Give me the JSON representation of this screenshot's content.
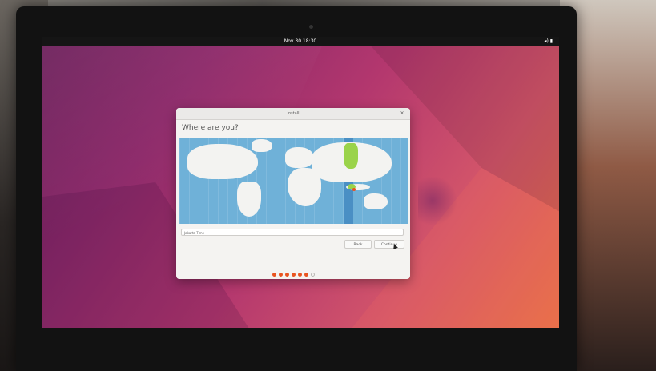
{
  "topbar": {
    "clock": "Nov 30  18:30",
    "status_icons": "◂) ▮"
  },
  "window": {
    "title": "Install",
    "heading": "Where are you?",
    "timezone_value": "Jakarta Time",
    "back_label": "Back",
    "continue_label": "Continue"
  },
  "progress": {
    "current_step": 6,
    "total_steps": 7
  },
  "colors": {
    "accent": "#e95420",
    "map_water": "#6fb1d8",
    "selected_region": "#9ad34a"
  }
}
